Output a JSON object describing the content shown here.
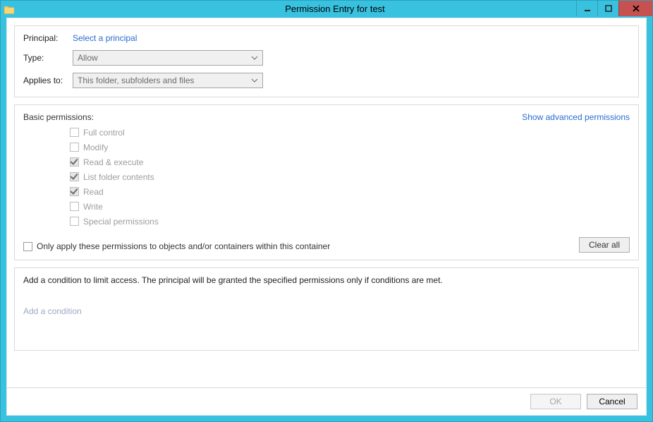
{
  "window": {
    "title": "Permission Entry for test"
  },
  "principal": {
    "label": "Principal:",
    "link": "Select a principal"
  },
  "type_row": {
    "label": "Type:",
    "value": "Allow"
  },
  "applies_row": {
    "label": "Applies to:",
    "value": "This folder, subfolders and files"
  },
  "permissions": {
    "heading": "Basic permissions:",
    "advanced_link": "Show advanced permissions",
    "items": [
      {
        "label": "Full control",
        "checked": false,
        "disabled": true
      },
      {
        "label": "Modify",
        "checked": false,
        "disabled": true
      },
      {
        "label": "Read & execute",
        "checked": true,
        "disabled": true
      },
      {
        "label": "List folder contents",
        "checked": true,
        "disabled": true
      },
      {
        "label": "Read",
        "checked": true,
        "disabled": true
      },
      {
        "label": "Write",
        "checked": false,
        "disabled": true
      },
      {
        "label": "Special permissions",
        "checked": false,
        "disabled": true
      }
    ],
    "only_apply_label": "Only apply these permissions to objects and/or containers within this container",
    "clear_all": "Clear all"
  },
  "condition": {
    "text": "Add a condition to limit access. The principal will be granted the specified permissions only if conditions are met.",
    "link": "Add a condition"
  },
  "footer": {
    "ok": "OK",
    "cancel": "Cancel"
  }
}
